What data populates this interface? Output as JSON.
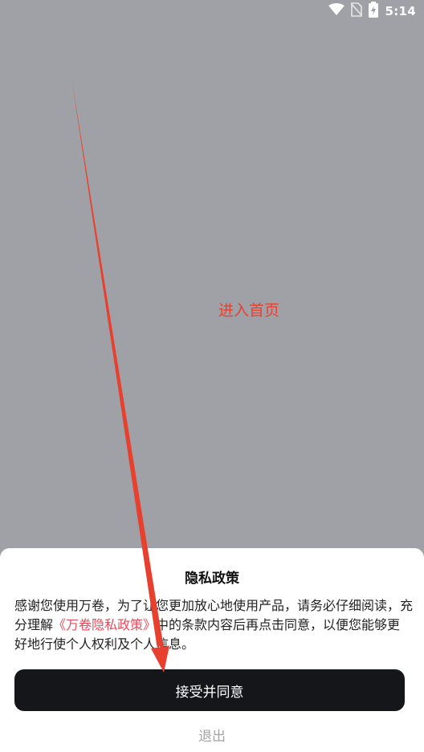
{
  "status_bar": {
    "time": "5:14",
    "icons": [
      "wifi-icon",
      "no-sim-icon",
      "battery-charging-icon"
    ]
  },
  "annotation": {
    "text": "进入首页",
    "color": "#e8402f"
  },
  "dialog": {
    "title": "隐私政策",
    "body_before": "感谢您使用万卷，为了让您更加放心地使用产品，请务必仔细阅读，充分理解",
    "policy_link": "《万卷隐私政策》",
    "body_after": "中的条款内容后再点击同意，以便您能够更好地行使个人权利及个人信息。",
    "accept_label": "接受并同意",
    "exit_label": "退出"
  },
  "colors": {
    "overlay_bg": "#a0a1a6",
    "link": "#e64a5b",
    "button_bg": "#15161a"
  }
}
